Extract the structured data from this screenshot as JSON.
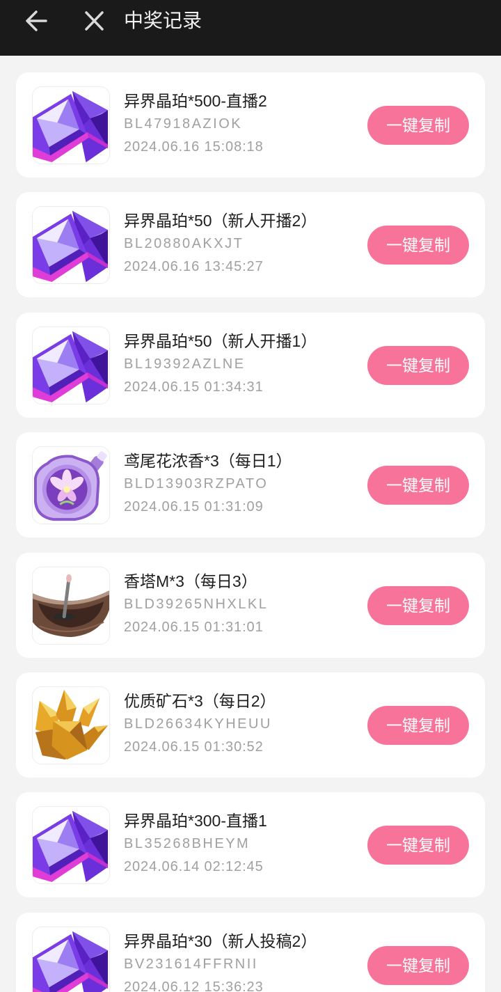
{
  "header": {
    "title": "中奖记录",
    "back_icon": "back-arrow-icon",
    "close_icon": "close-icon"
  },
  "colors": {
    "header_bg": "#1a1a1a",
    "page_bg": "#f3f3f3",
    "card_bg": "#ffffff",
    "button_bg": "#f7739a",
    "title_text": "#1e1e1e",
    "secondary_text": "#a0a0a0"
  },
  "copy_button_label": "一键复制",
  "records": [
    {
      "icon": "crystal-icon",
      "title": "异界晶珀*500-直播2",
      "code": "BL47918AZIOK",
      "time": "2024.06.16 15:08:18"
    },
    {
      "icon": "crystal-icon",
      "title": "异界晶珀*50（新人开播2）",
      "code": "BL20880AKXJT",
      "time": "2024.06.16 13:45:27"
    },
    {
      "icon": "crystal-icon",
      "title": "异界晶珀*50（新人开播1）",
      "code": "BL19392AZLNE",
      "time": "2024.06.15 01:34:31"
    },
    {
      "icon": "perfume-bottle-icon",
      "title": "鸢尾花浓香*3（每日1）",
      "code": "BLD13903RZPATO",
      "time": "2024.06.15 01:31:09"
    },
    {
      "icon": "incense-boat-icon",
      "title": "香塔M*3（每日3）",
      "code": "BLD39265NHXLKL",
      "time": "2024.06.15 01:31:01"
    },
    {
      "icon": "gold-ore-icon",
      "title": "优质矿石*3（每日2）",
      "code": "BLD26634KYHEUU",
      "time": "2024.06.15 01:30:52"
    },
    {
      "icon": "crystal-icon",
      "title": "异界晶珀*300-直播1",
      "code": "BL35268BHEYM",
      "time": "2024.06.14 02:12:45"
    },
    {
      "icon": "crystal-icon",
      "title": "异界晶珀*30（新人投稿2）",
      "code": "BV231614FFRNII",
      "time": "2024.06.12 15:36:23"
    }
  ]
}
